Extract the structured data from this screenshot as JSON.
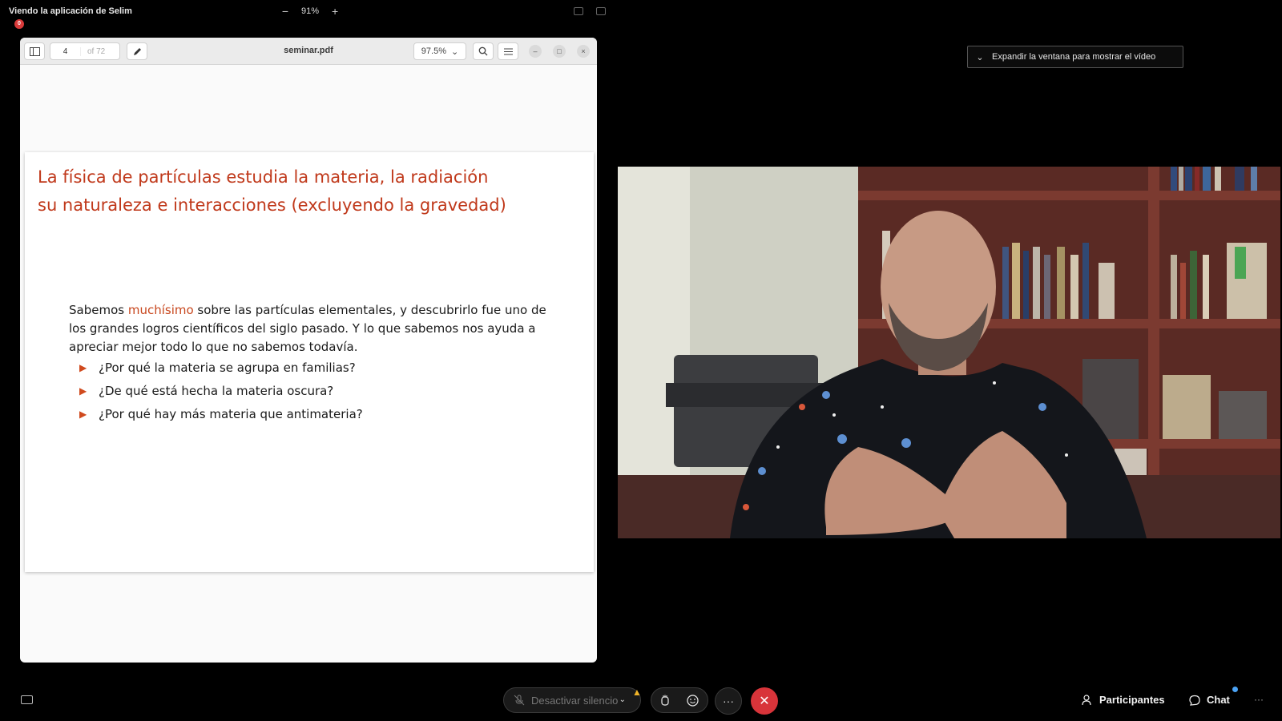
{
  "app": {
    "viewing_label": "Viendo la aplicación de Selim",
    "recording_badge": "0",
    "zoom": {
      "minus": "−",
      "value": "91%",
      "plus": "+"
    }
  },
  "pdf_viewer": {
    "page_current": "4",
    "page_total": "of 72",
    "filename": "seminar.pdf",
    "zoom_value": "97.5%",
    "zoom_chevron": "⌄",
    "minimize": "–",
    "maximize": "□",
    "close": "×"
  },
  "slide": {
    "title_line1": "La física de partículas estudia la materia, la radiación",
    "title_line2": "su naturaleza e interacciones (excluyendo la gravedad)",
    "body_pre": "Sabemos ",
    "body_highlight": "muchísimo",
    "body_post": " sobre las partículas elementales, y descubrirlo fue uno de los grandes logros científicos del siglo pasado. Y lo que sabemos nos ayuda a apreciar mejor todo lo que no sabemos todavía.",
    "bullet_marker": "▶",
    "bullets": [
      "¿Por qué la materia se agrupa en familias?",
      "¿De qué está hecha la materia oscura?",
      "¿Por qué hay más materia que antimateria?"
    ],
    "colors": {
      "title": "#c0391b",
      "highlight": "#c8471e"
    }
  },
  "video": {
    "expand_label": "Expandir la ventana para mostrar el vídeo",
    "expand_chevron": "⌄"
  },
  "controls": {
    "mute_label": "Desactivar silencio",
    "warning_symbol": "▲",
    "mute_chevron": "⌄",
    "more_symbol": "···",
    "end_symbol": "✕",
    "participants_label": "Participantes",
    "chat_label": "Chat",
    "overflow_symbol": "···"
  }
}
